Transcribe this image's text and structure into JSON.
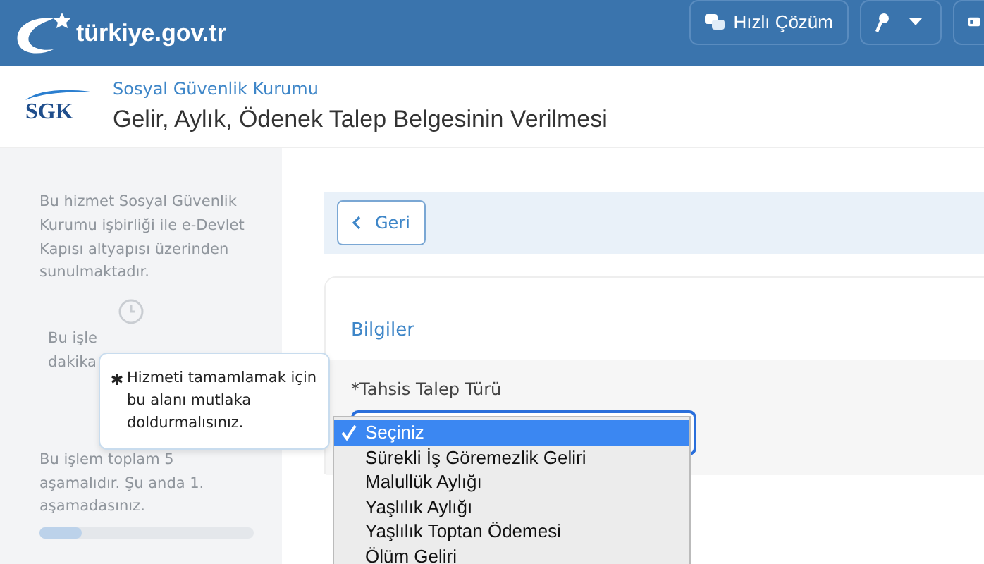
{
  "header": {
    "logo_text": "türkiye.gov.tr",
    "buttons": [
      {
        "kind": "quick",
        "label": "Hızlı Çözüm"
      },
      {
        "kind": "key"
      },
      {
        "kind": "card"
      }
    ]
  },
  "institution": {
    "name": "Sosyal Güvenlik Kurumu",
    "logo_text": "SGK",
    "title": "Gelir, Aylık, Ödenek Talep Belgesinin Verilmesi"
  },
  "sidebar": {
    "info": "Bu hizmet Sosyal Güvenlik Kurumu işbirliği ile e-Devlet Kapısı altyapısı üzerinden sunulmaktadır.",
    "duration_lines": [
      "Bu işle",
      "dakika"
    ],
    "steps": "Bu işlem toplam 5 aşamalıdır. Şu anda 1. aşamadasınız.",
    "progress": {
      "level": 0.2
    }
  },
  "tooltip": {
    "text": "Hizmeti tamamlamak için bu alanı mutlaka doldurmalısınız."
  },
  "back_button": {
    "label": "Geri"
  },
  "section": {
    "title": "Bilgiler",
    "field_label": "*Tahsis Talep Türü"
  },
  "dropdown": {
    "options": [
      {
        "label": "Seçiniz",
        "selected": true
      },
      {
        "label": "Sürekli İş Göremezlik Geliri",
        "selected": false
      },
      {
        "label": "Malullük Aylığı",
        "selected": false
      },
      {
        "label": "Yaşlılık Aylığı",
        "selected": false
      },
      {
        "label": "Yaşlılık Toptan Ödemesi",
        "selected": false
      },
      {
        "label": "Ölüm Geliri",
        "selected": false
      }
    ]
  }
}
